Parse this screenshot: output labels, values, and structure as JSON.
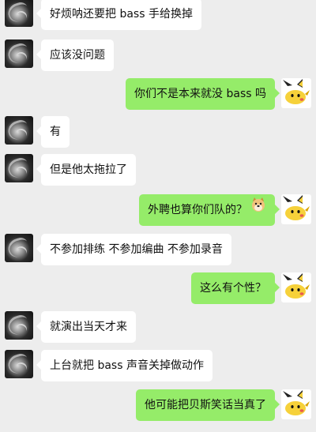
{
  "chat": {
    "messages": [
      {
        "side": "left",
        "text": "好烦呐还要把 bass 手给换掉"
      },
      {
        "side": "left",
        "text": "应该没问题"
      },
      {
        "side": "right",
        "text": "你们不是本来就没 bass 吗"
      },
      {
        "side": "left",
        "text": "有"
      },
      {
        "side": "left",
        "text": "但是他太拖拉了"
      },
      {
        "side": "right",
        "text": "外聘也算你们队的？",
        "emoji": "doge-face-icon"
      },
      {
        "side": "left",
        "text": "不参加排练 不参加编曲 不参加录音"
      },
      {
        "side": "right",
        "text": "这么有个性？"
      },
      {
        "side": "left",
        "text": "就演出当天才来"
      },
      {
        "side": "left",
        "text": "上台就把 bass 声音关掉做动作"
      },
      {
        "side": "right",
        "text": "他可能把贝斯笑话当真了"
      }
    ]
  },
  "colors": {
    "background": "#ededed",
    "incoming_bubble": "#ffffff",
    "outgoing_bubble": "#95ec69"
  }
}
